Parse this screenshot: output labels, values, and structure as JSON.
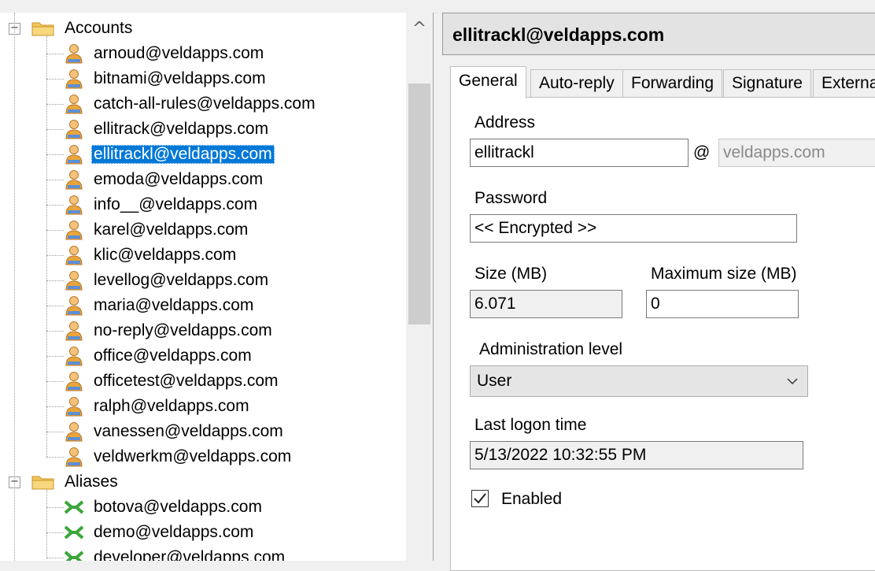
{
  "tree": {
    "accounts_group": {
      "label": "Accounts",
      "items": [
        "arnoud@veldapps.com",
        "bitnami@veldapps.com",
        "catch-all-rules@veldapps.com",
        "ellitrack@veldapps.com",
        "ellitrackl@veldapps.com",
        "emoda@veldapps.com",
        "info__@veldapps.com",
        "karel@veldapps.com",
        "klic@veldapps.com",
        "levellog@veldapps.com",
        "maria@veldapps.com",
        "no-reply@veldapps.com",
        "office@veldapps.com",
        "officetest@veldapps.com",
        "ralph@veldapps.com",
        "vanessen@veldapps.com",
        "veldwerkm@veldapps.com"
      ],
      "selected_index": 4
    },
    "aliases_group": {
      "label": "Aliases",
      "items": [
        "botova@veldapps.com",
        "demo@veldapps.com",
        "developer@veldapps.com"
      ]
    },
    "expander_symbol": "−",
    "scroll_up_glyph": "^"
  },
  "detail": {
    "header_title": "ellitrackl@veldapps.com",
    "tabs": [
      "General",
      "Auto-reply",
      "Forwarding",
      "Signature",
      "External"
    ],
    "active_tab": "General",
    "general": {
      "address_label": "Address",
      "address_value": "ellitrackl",
      "at_sign": "@",
      "domain_value": "veldapps.com",
      "password_label": "Password",
      "password_value": "<< Encrypted >>",
      "size_label": "Size (MB)",
      "size_value": "6.071",
      "max_size_label": "Maximum size (MB)",
      "max_size_value": "0",
      "admin_level_label": "Administration level",
      "admin_level_value": "User",
      "last_logon_label": "Last logon time",
      "last_logon_value": "5/13/2022 10:32:55 PM",
      "enabled_label": "Enabled",
      "enabled_checked": true
    }
  },
  "colors": {
    "selection": "#0078d7",
    "folder": "#f3c65a",
    "user_icon": "#e9a53a",
    "alias_icon": "#3aa63a"
  }
}
